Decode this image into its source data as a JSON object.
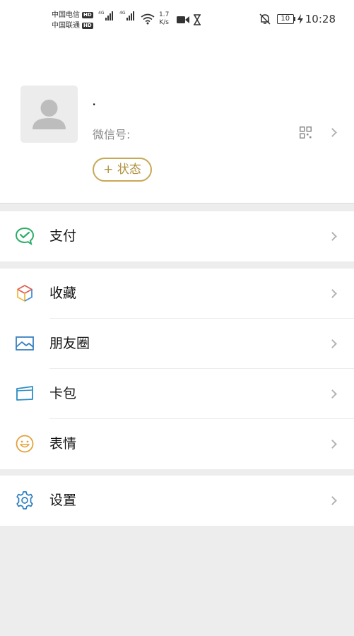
{
  "status_bar": {
    "carrier1": "中国电信",
    "carrier2": "中国联通",
    "hd_badge": "HD",
    "network1": "4G",
    "network2": "4G",
    "speed_value": "1.7",
    "speed_unit": "K/s",
    "battery": "10",
    "time": "10:28"
  },
  "profile": {
    "nickname": "·",
    "wechat_id_label": "微信号:",
    "status_button": "+ 状态"
  },
  "menu": {
    "pay": "支付",
    "favorites": "收藏",
    "moments": "朋友圈",
    "cards": "卡包",
    "stickers": "表情",
    "settings": "设置"
  },
  "colors": {
    "accent_gold": "#c8a856",
    "pay_green": "#2aae67",
    "background": "#ededed"
  }
}
